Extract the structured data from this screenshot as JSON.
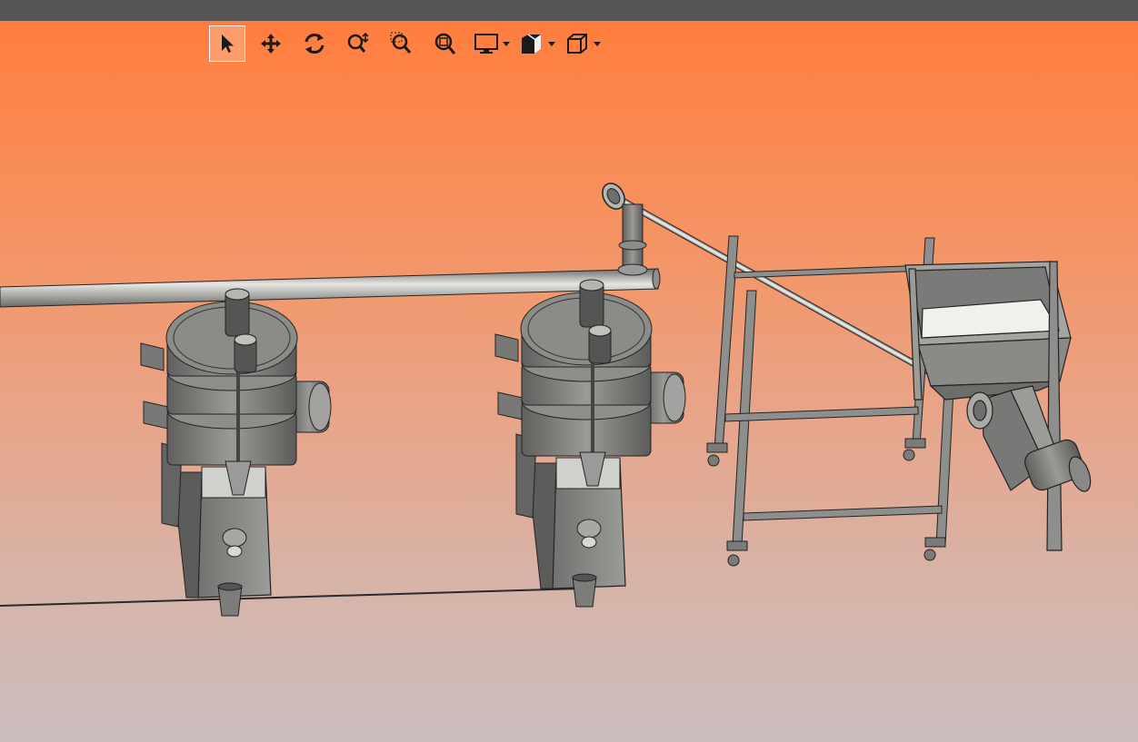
{
  "toolbar": {
    "tools": [
      {
        "name": "select",
        "icon": "select-arrow-icon",
        "active": true
      },
      {
        "name": "pan",
        "icon": "pan-move-icon",
        "active": false
      },
      {
        "name": "rotate",
        "icon": "rotate-icon",
        "active": false
      },
      {
        "name": "zoom",
        "icon": "zoom-icon",
        "active": false
      },
      {
        "name": "zoom-window",
        "icon": "zoom-window-icon",
        "active": false
      },
      {
        "name": "zoom-fit",
        "icon": "zoom-fit-icon",
        "active": false
      }
    ],
    "dropdowns": [
      {
        "name": "display-mode",
        "icon": "monitor-icon"
      },
      {
        "name": "section-views",
        "icon": "section-cube-icon"
      },
      {
        "name": "view-orientation",
        "icon": "view-cube-icon"
      }
    ]
  },
  "colors": {
    "viewport_top": "#ff7e3d",
    "viewport_bottom": "#cbbdbe",
    "metal": "#8a8a88",
    "metal_dark": "#5a5a58",
    "edge": "#1e1e1e"
  }
}
